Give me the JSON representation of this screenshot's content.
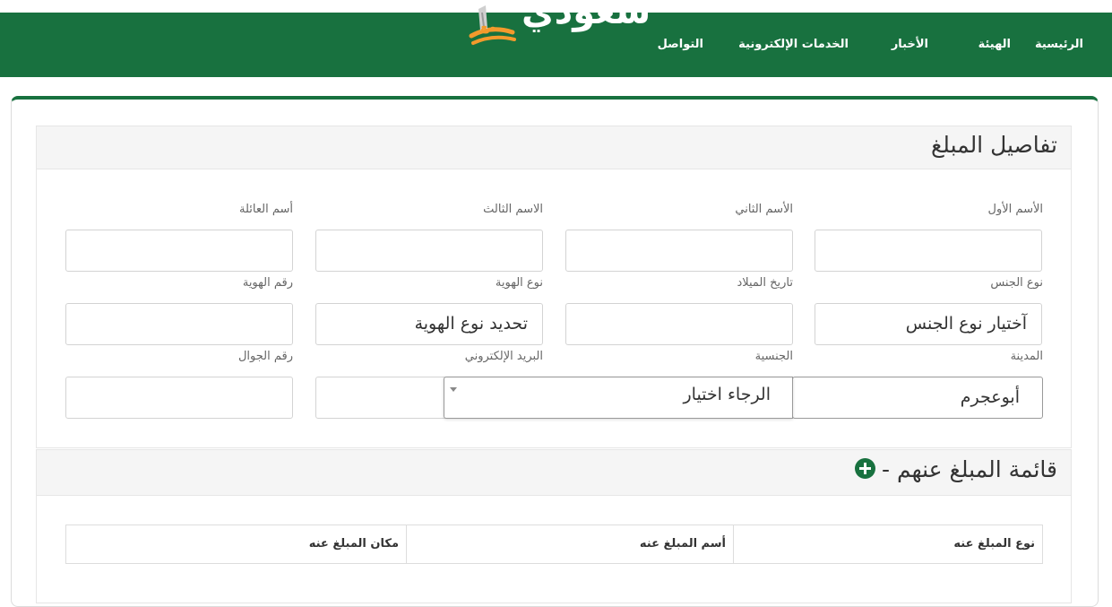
{
  "header": {
    "logo_text": "سعودي",
    "nav": [
      "الرئيسية",
      "الهيئة",
      "الأخبار",
      "الخدمات الإلكترونية",
      "التواصل"
    ]
  },
  "form_panel": {
    "title": "تفاصيل المبلغ",
    "fields": {
      "first_name": {
        "label": "الأسم الأول",
        "value": ""
      },
      "second_name": {
        "label": "الأسم الثاني",
        "value": ""
      },
      "third_name": {
        "label": "الاسم الثالث",
        "value": ""
      },
      "family_name": {
        "label": "أسم العائلة",
        "value": ""
      },
      "gender": {
        "label": "نوع الجنس",
        "value": "آختيار نوع الجنس"
      },
      "birth_date": {
        "label": "تاريخ الميلاد",
        "value": ""
      },
      "id_type": {
        "label": "نوع الهوية",
        "value": "تحديد نوع الهوية"
      },
      "id_number": {
        "label": "رقم الهوية",
        "value": ""
      },
      "city": {
        "label": "المدينة",
        "value": "أبوعجرم"
      },
      "nationality": {
        "label": "الجنسية",
        "value": "الرجاء اختيار"
      },
      "email": {
        "label": "البريد الإلكتروني",
        "value": ""
      },
      "mobile": {
        "label": "رقم الجوال",
        "value": ""
      }
    }
  },
  "list_panel": {
    "title": "قائمة المبلغ عنهم -",
    "table_headers": [
      "نوع المبلغ عنه",
      "أسم المبلغ عنه",
      "مكان المبلغ عنه"
    ]
  },
  "colors": {
    "brand": "#18713f"
  }
}
